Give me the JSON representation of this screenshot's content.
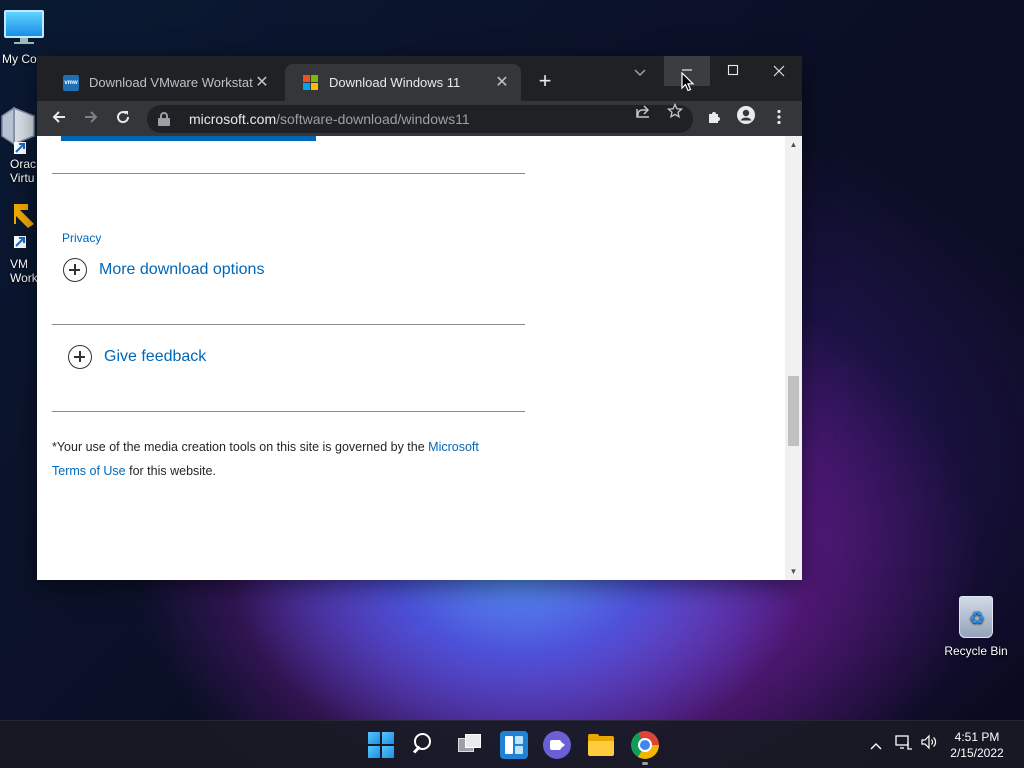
{
  "desktop": {
    "icons": [
      {
        "label": "My Co"
      },
      {
        "label": "Orac\nVirtu"
      },
      {
        "label": "VM\nWork"
      }
    ],
    "recycle_bin": {
      "label": "Recycle Bin"
    }
  },
  "browser": {
    "tabs": [
      {
        "title": "Download VMware Workstation P",
        "favicon_text": "vmw",
        "active": false
      },
      {
        "title": "Download Windows 11",
        "active": true
      }
    ],
    "address": {
      "host": "microsoft.com",
      "path": "/software-download/windows11"
    },
    "page": {
      "privacy_label": "Privacy",
      "more_options_label": "More download options",
      "feedback_label": "Give feedback",
      "disclaimer_prefix": "*Your use of the media creation tools on this site is governed by the ",
      "disclaimer_link": "Microsoft Terms of Use",
      "disclaimer_suffix": " for this website."
    },
    "colors": {
      "link": "#0067b8",
      "accent_bar": "#0067b8",
      "tabstrip": "#202124",
      "toolbar": "#35363a"
    }
  },
  "taskbar": {
    "apps": [
      "start-icon",
      "search-icon",
      "task-view-icon",
      "widgets-icon",
      "chat-icon",
      "file-explorer-icon",
      "chrome-icon"
    ],
    "clock": {
      "time": "4:51 PM",
      "date": "2/15/2022"
    }
  }
}
